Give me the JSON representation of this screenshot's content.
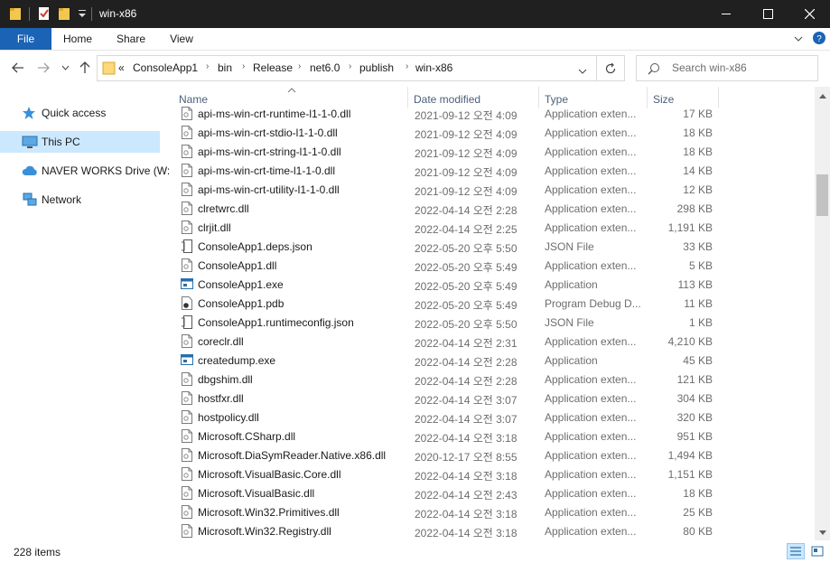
{
  "window": {
    "title": "win-x86"
  },
  "ribbon": {
    "tabs": [
      "File",
      "Home",
      "Share",
      "View"
    ]
  },
  "address": {
    "overflow": "«",
    "crumbs": [
      "ConsoleApp1",
      "bin",
      "Release",
      "net6.0",
      "publish",
      "win-x86"
    ]
  },
  "search": {
    "placeholder": "Search win-x86"
  },
  "nav": {
    "items": [
      {
        "label": "Quick access",
        "icon": "star-icon"
      },
      {
        "label": "This PC",
        "icon": "pc-icon"
      },
      {
        "label": "NAVER WORKS Drive (W:",
        "icon": "cloud-icon"
      },
      {
        "label": "Network",
        "icon": "network-icon"
      }
    ]
  },
  "columns": {
    "name": "Name",
    "date": "Date modified",
    "type": "Type",
    "size": "Size"
  },
  "files": [
    {
      "name": "api-ms-win-crt-runtime-l1-1-0.dll",
      "date": "2021-09-12 오전 4:09",
      "type": "Application exten...",
      "size": "17 KB",
      "icon": "dll"
    },
    {
      "name": "api-ms-win-crt-stdio-l1-1-0.dll",
      "date": "2021-09-12 오전 4:09",
      "type": "Application exten...",
      "size": "18 KB",
      "icon": "dll"
    },
    {
      "name": "api-ms-win-crt-string-l1-1-0.dll",
      "date": "2021-09-12 오전 4:09",
      "type": "Application exten...",
      "size": "18 KB",
      "icon": "dll"
    },
    {
      "name": "api-ms-win-crt-time-l1-1-0.dll",
      "date": "2021-09-12 오전 4:09",
      "type": "Application exten...",
      "size": "14 KB",
      "icon": "dll"
    },
    {
      "name": "api-ms-win-crt-utility-l1-1-0.dll",
      "date": "2021-09-12 오전 4:09",
      "type": "Application exten...",
      "size": "12 KB",
      "icon": "dll"
    },
    {
      "name": "clretwrc.dll",
      "date": "2022-04-14 오전 2:28",
      "type": "Application exten...",
      "size": "298 KB",
      "icon": "dll"
    },
    {
      "name": "clrjit.dll",
      "date": "2022-04-14 오전 2:25",
      "type": "Application exten...",
      "size": "1,191 KB",
      "icon": "dll"
    },
    {
      "name": "ConsoleApp1.deps.json",
      "date": "2022-05-20 오후 5:50",
      "type": "JSON File",
      "size": "33 KB",
      "icon": "json"
    },
    {
      "name": "ConsoleApp1.dll",
      "date": "2022-05-20 오후 5:49",
      "type": "Application exten...",
      "size": "5 KB",
      "icon": "dll"
    },
    {
      "name": "ConsoleApp1.exe",
      "date": "2022-05-20 오후 5:49",
      "type": "Application",
      "size": "113 KB",
      "icon": "exe"
    },
    {
      "name": "ConsoleApp1.pdb",
      "date": "2022-05-20 오후 5:49",
      "type": "Program Debug D...",
      "size": "11 KB",
      "icon": "pdb"
    },
    {
      "name": "ConsoleApp1.runtimeconfig.json",
      "date": "2022-05-20 오후 5:50",
      "type": "JSON File",
      "size": "1 KB",
      "icon": "json"
    },
    {
      "name": "coreclr.dll",
      "date": "2022-04-14 오전 2:31",
      "type": "Application exten...",
      "size": "4,210 KB",
      "icon": "dll"
    },
    {
      "name": "createdump.exe",
      "date": "2022-04-14 오전 2:28",
      "type": "Application",
      "size": "45 KB",
      "icon": "exe"
    },
    {
      "name": "dbgshim.dll",
      "date": "2022-04-14 오전 2:28",
      "type": "Application exten...",
      "size": "121 KB",
      "icon": "dll"
    },
    {
      "name": "hostfxr.dll",
      "date": "2022-04-14 오전 3:07",
      "type": "Application exten...",
      "size": "304 KB",
      "icon": "dll"
    },
    {
      "name": "hostpolicy.dll",
      "date": "2022-04-14 오전 3:07",
      "type": "Application exten...",
      "size": "320 KB",
      "icon": "dll"
    },
    {
      "name": "Microsoft.CSharp.dll",
      "date": "2022-04-14 오전 3:18",
      "type": "Application exten...",
      "size": "951 KB",
      "icon": "dll"
    },
    {
      "name": "Microsoft.DiaSymReader.Native.x86.dll",
      "date": "2020-12-17 오전 8:55",
      "type": "Application exten...",
      "size": "1,494 KB",
      "icon": "dll"
    },
    {
      "name": "Microsoft.VisualBasic.Core.dll",
      "date": "2022-04-14 오전 3:18",
      "type": "Application exten...",
      "size": "1,151 KB",
      "icon": "dll"
    },
    {
      "name": "Microsoft.VisualBasic.dll",
      "date": "2022-04-14 오전 2:43",
      "type": "Application exten...",
      "size": "18 KB",
      "icon": "dll"
    },
    {
      "name": "Microsoft.Win32.Primitives.dll",
      "date": "2022-04-14 오전 3:18",
      "type": "Application exten...",
      "size": "25 KB",
      "icon": "dll"
    },
    {
      "name": "Microsoft.Win32.Registry.dll",
      "date": "2022-04-14 오전 3:18",
      "type": "Application exten...",
      "size": "80 KB",
      "icon": "dll"
    }
  ],
  "status": {
    "count": "228 items"
  }
}
